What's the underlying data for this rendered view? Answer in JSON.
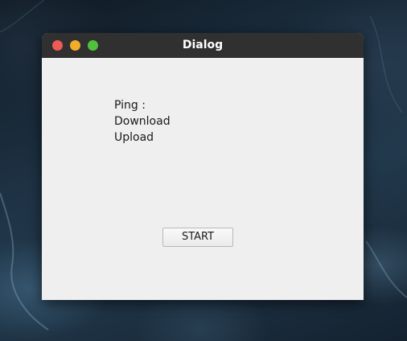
{
  "window": {
    "title": "Dialog",
    "controls": {
      "close_color": "#ec5b56",
      "minimize_color": "#f0ae2b",
      "maximize_color": "#4fc23b"
    }
  },
  "labels": {
    "ping": "Ping :",
    "download": "Download",
    "upload": "Upload"
  },
  "buttons": {
    "start": "START"
  }
}
